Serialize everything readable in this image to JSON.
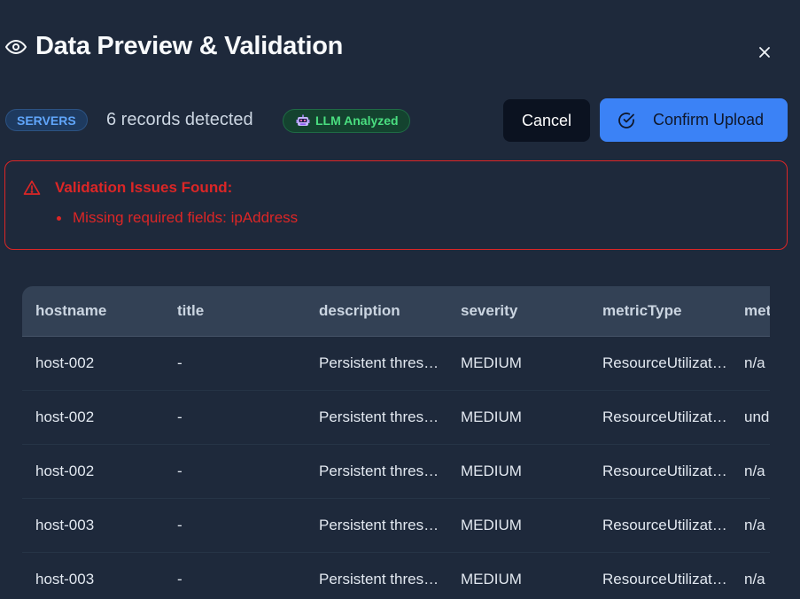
{
  "header": {
    "title": "Data Preview & Validation",
    "icon": "eye-icon",
    "close_icon": "close-icon"
  },
  "toolbar": {
    "type_badge": "SERVERS",
    "records_text": "6 records detected",
    "llm_badge": "LLM Analyzed",
    "cancel_label": "Cancel",
    "confirm_label": "Confirm Upload"
  },
  "alert": {
    "title": "Validation Issues Found:",
    "issues": [
      "Missing required fields: ipAddress"
    ]
  },
  "table": {
    "columns": [
      "hostname",
      "title",
      "description",
      "severity",
      "metricType",
      "metricValue"
    ],
    "rows": [
      [
        "host-002",
        "-",
        "Persistent threshold breach",
        "MEDIUM",
        "ResourceUtilization",
        "n/a"
      ],
      [
        "host-002",
        "-",
        "Persistent threshold breach",
        "MEDIUM",
        "ResourceUtilization",
        "undefined"
      ],
      [
        "host-002",
        "-",
        "Persistent threshold breach",
        "MEDIUM",
        "ResourceUtilization",
        "n/a"
      ],
      [
        "host-003",
        "-",
        "Persistent threshold breach",
        "MEDIUM",
        "ResourceUtilization",
        "n/a"
      ],
      [
        "host-003",
        "-",
        "Persistent threshold breach",
        "MEDIUM",
        "ResourceUtilization",
        "n/a"
      ]
    ]
  },
  "colors": {
    "background": "#1e293b",
    "accent": "#3b82f6",
    "error": "#dc2626",
    "success": "#4ade80"
  }
}
